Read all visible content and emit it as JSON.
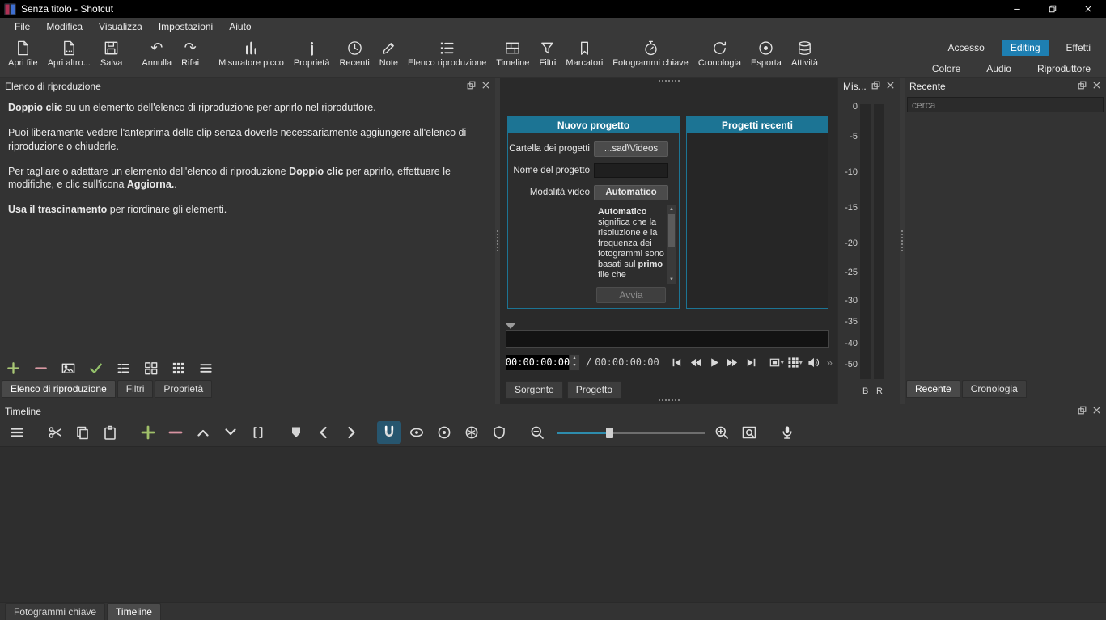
{
  "window": {
    "title": "Senza titolo - Shotcut"
  },
  "menubar": [
    "File",
    "Modifica",
    "Visualizza",
    "Impostazioni",
    "Aiuto"
  ],
  "toolbar": {
    "items": [
      "Apri file",
      "Apri altro...",
      "Salva",
      "Annulla",
      "Rifai",
      "Misuratore picco",
      "Proprietà",
      "Recenti",
      "Note",
      "Elenco riproduzione",
      "Timeline",
      "Filtri",
      "Marcatori",
      "Fotogrammi chiave",
      "Cronologia",
      "Esporta",
      "Attività"
    ],
    "layout_row1": [
      "Accesso",
      "Editing",
      "Effetti"
    ],
    "layout_row2": [
      "Colore",
      "Audio",
      "Riproduttore"
    ]
  },
  "playlist": {
    "title": "Elenco di riproduzione",
    "p1": [
      "Doppio clic",
      " su un elemento dell'elenco di riproduzione per aprirlo nel riproduttore."
    ],
    "p2": "Puoi liberamente vedere l'anteprima delle clip senza doverle necessariamente aggiungere all'elenco di riproduzione o chiuderle.",
    "p3": [
      "Per tagliare o adattare un elemento dell'elenco di riproduzione ",
      "Doppio clic",
      " per aprirlo, effettuare le modifiche, e clic sull'icona ",
      "Aggiorna.",
      "."
    ],
    "p4": [
      "Usa il trascinamento",
      " per riordinare gli elementi."
    ],
    "tabs": [
      "Elenco di riproduzione",
      "Filtri",
      "Proprietà"
    ]
  },
  "new_project": {
    "title": "Nuovo progetto",
    "folder_label": "Cartella dei progetti",
    "folder_value": "...sad\\Videos",
    "name_label": "Nome del progetto",
    "mode_label": "Modalità video",
    "mode_value": "Automatico",
    "desc": [
      "Automatico",
      " significa che la risoluzione e la frequenza dei fotogrammi sono basati sul ",
      "primo",
      " file che"
    ],
    "start_button": "Avvia"
  },
  "recent_projects": {
    "title": "Progetti recenti"
  },
  "player": {
    "position": "00:00:00:00",
    "sep": "/",
    "duration": "00:00:00:00",
    "tabs": [
      "Sorgente",
      "Progetto"
    ]
  },
  "meter": {
    "title": "Mis...",
    "scale": [
      "0",
      "-5",
      "-10",
      "-15",
      "-20",
      "-25",
      "-30",
      "-35",
      "-40",
      "-50"
    ],
    "channels": [
      "B",
      "R"
    ]
  },
  "recent_panel": {
    "title": "Recente",
    "search_placeholder": "cerca",
    "tabs": [
      "Recente",
      "Cronologia"
    ]
  },
  "timeline": {
    "title": "Timeline"
  },
  "bottom_tabs": [
    "Fotogrammi chiave",
    "Timeline"
  ],
  "icons": {
    "undo": "↶",
    "redo": "↷",
    "more": "»",
    "caret": "▾",
    "spin_up": "▴",
    "spin_down": "▾",
    "scroll_up": "▲",
    "scroll_down": "▼"
  }
}
